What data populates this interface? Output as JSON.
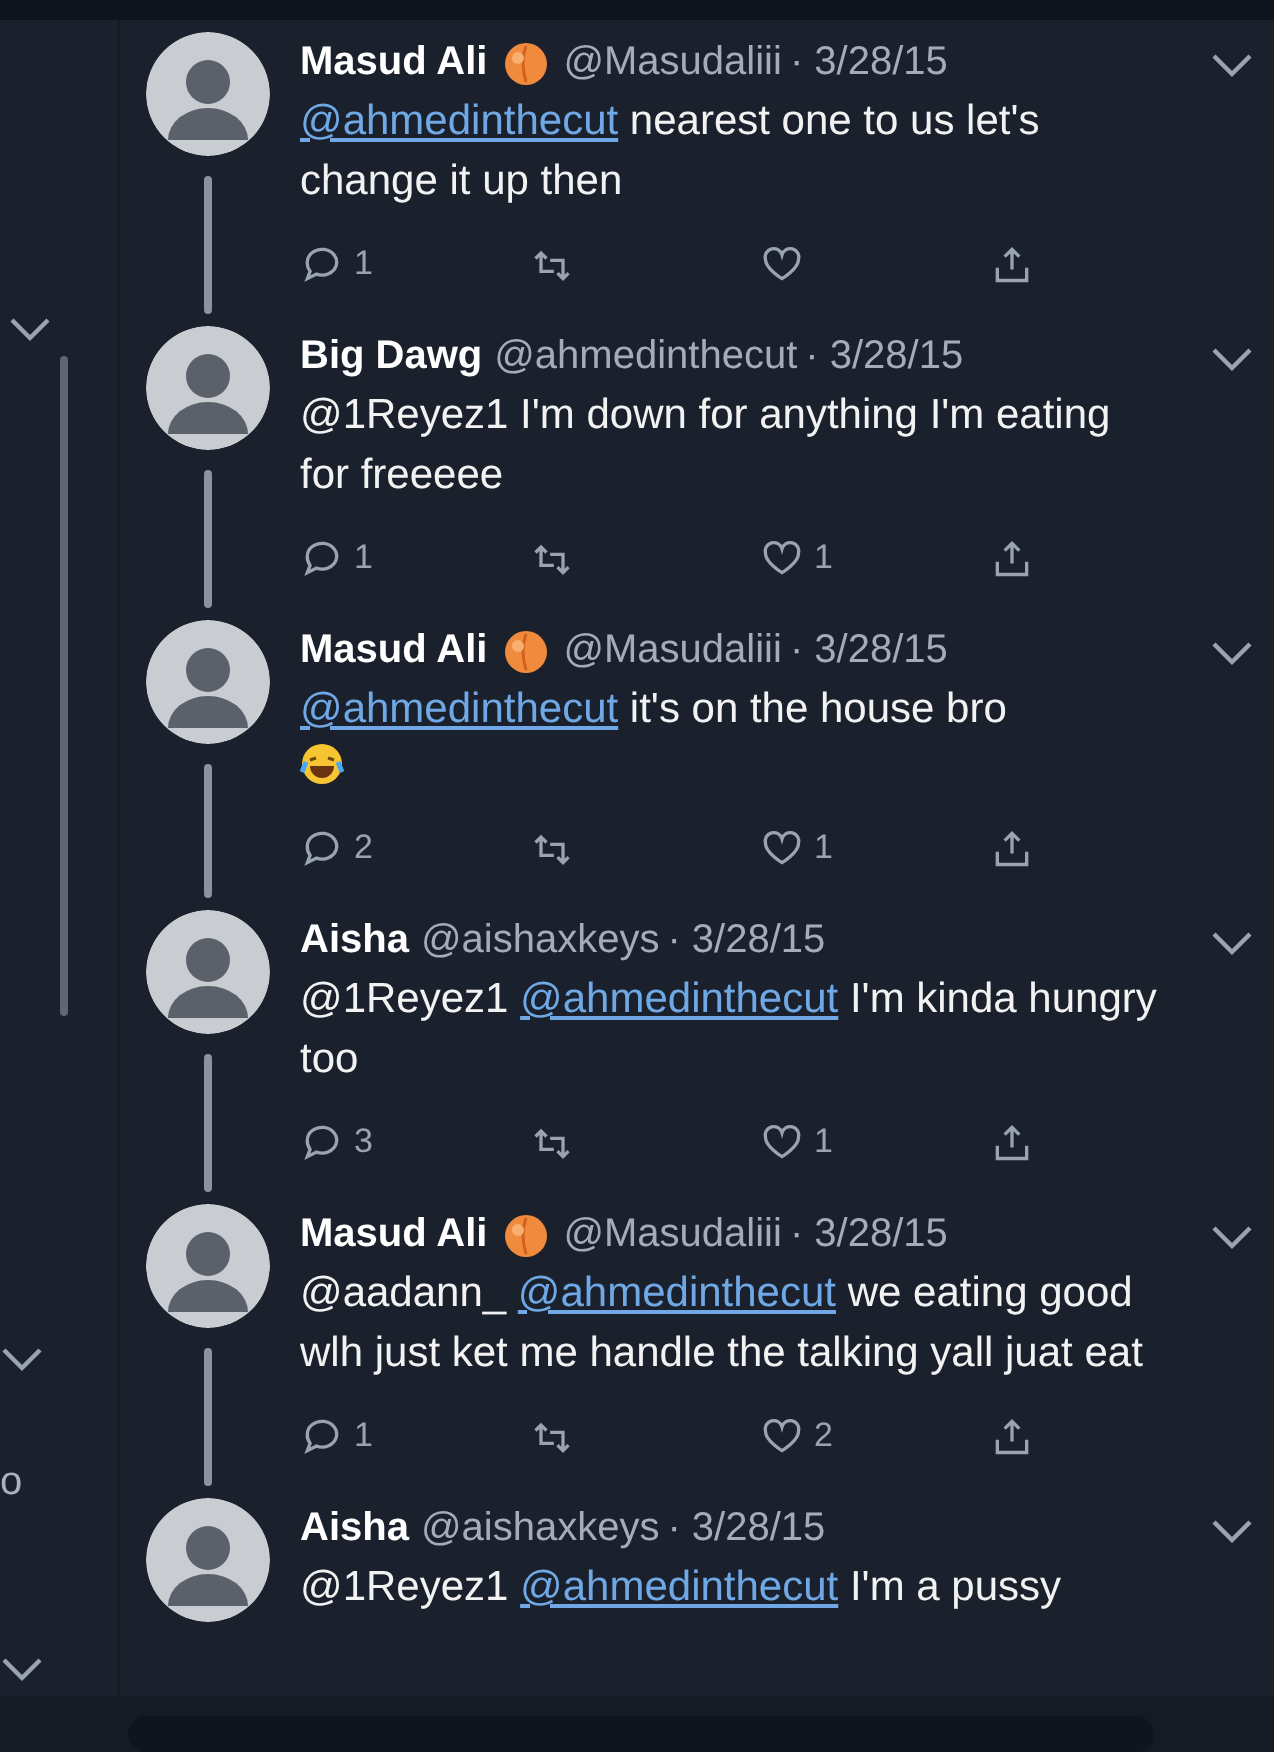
{
  "background_fragment": {
    "text": "o"
  },
  "tweets": [
    {
      "name": "Masud Ali",
      "peach": true,
      "handle": "@Masudaliii",
      "date": "· 3/28/15",
      "text": [
        {
          "kind": "mention",
          "text": "@ahmedinthecut"
        },
        {
          "kind": "plain",
          "text": " nearest one to us let's change it up then"
        }
      ],
      "replies": "1",
      "thread_line": true
    },
    {
      "name": "Big Dawg",
      "peach": false,
      "handle": "@ahmedinthecut",
      "date": "· 3/28/15",
      "text": [
        {
          "kind": "plain",
          "text": "@1Reyez1 I'm down for anything I'm eating for freeeee"
        }
      ],
      "replies": "1",
      "likes": "1",
      "thread_line": true
    },
    {
      "name": "Masud Ali",
      "peach": true,
      "handle": "@Masudaliii",
      "date": "· 3/28/15",
      "text": [
        {
          "kind": "mention",
          "text": "@ahmedinthecut"
        },
        {
          "kind": "plain",
          "text": " it's on the house bro"
        },
        {
          "kind": "laugh-emoji"
        }
      ],
      "replies": "2",
      "likes": "1",
      "thread_line": true
    },
    {
      "name": "Aisha",
      "peach": false,
      "handle": "@aishaxkeys",
      "date": "· 3/28/15",
      "text": [
        {
          "kind": "plain",
          "text": "@1Reyez1 "
        },
        {
          "kind": "mention",
          "text": "@ahmedinthecut"
        },
        {
          "kind": "plain",
          "text": " I'm kinda hungry too"
        }
      ],
      "replies": "3",
      "likes": "1",
      "thread_line": true
    },
    {
      "name": "Masud Ali",
      "peach": true,
      "handle": "@Masudaliii",
      "date": "· 3/28/15",
      "text": [
        {
          "kind": "plain",
          "text": "@aadann_ "
        },
        {
          "kind": "mention",
          "text": "@ahmedinthecut"
        },
        {
          "kind": "plain",
          "text": " we eating good wlh just ket me handle the talking yall juat eat"
        }
      ],
      "replies": "1",
      "likes": "2",
      "thread_line": true
    },
    {
      "name": "Aisha",
      "peach": false,
      "handle": "@aishaxkeys",
      "date": "· 3/28/15",
      "text": [
        {
          "kind": "plain",
          "text": "@1Reyez1 "
        },
        {
          "kind": "mention",
          "text": "@ahmedinthecut"
        },
        {
          "kind": "plain",
          "text": " I'm a pussy"
        }
      ],
      "thread_line": false,
      "cut": true
    }
  ]
}
